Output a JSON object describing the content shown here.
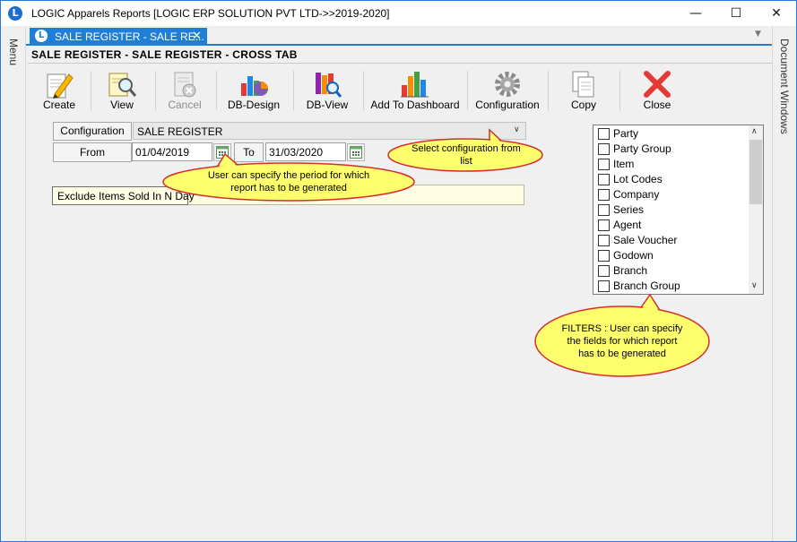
{
  "window": {
    "title": "LOGIC Apparels Reports  [LOGIC ERP SOLUTION PVT LTD->>2019-2020]",
    "app_icon_glyph": "L",
    "minimize_glyph": "—",
    "maximize_glyph": "☐",
    "close_glyph": "✕"
  },
  "rails": {
    "left_label": "Menu",
    "right_label": "Document Windows"
  },
  "tabs": {
    "active_label": "SALE REGISTER - SALE RE...",
    "close_glyph": "✕",
    "overflow_glyph": "▼"
  },
  "page": {
    "heading": "SALE REGISTER - SALE REGISTER - CROSS TAB"
  },
  "toolbar": {
    "create": "Create",
    "view": "View",
    "cancel": "Cancel",
    "db_design": "DB-Design",
    "db_view": "DB-View",
    "add_dashboard": "Add To Dashboard",
    "configuration": "Configuration",
    "copy": "Copy",
    "close": "Close"
  },
  "form": {
    "configuration_label": "Configuration",
    "configuration_value": "SALE REGISTER",
    "combo_arrow": "∨",
    "from_label": "From",
    "from_value": "01/04/2019",
    "to_label": "To",
    "to_value": "31/03/2020",
    "exclude_label": "Exclude Items Sold In N Day",
    "exclude_value": ""
  },
  "filters": {
    "items": [
      {
        "label": "Party",
        "checked": false
      },
      {
        "label": "Party Group",
        "checked": false
      },
      {
        "label": "Item",
        "checked": false
      },
      {
        "label": "Lot Codes",
        "checked": false
      },
      {
        "label": "Company",
        "checked": false
      },
      {
        "label": "Series",
        "checked": false
      },
      {
        "label": "Agent",
        "checked": false
      },
      {
        "label": "Sale Voucher",
        "checked": false
      },
      {
        "label": "Godown",
        "checked": false
      },
      {
        "label": "Branch",
        "checked": false
      },
      {
        "label": "Branch Group",
        "checked": false
      }
    ],
    "scroll_up": "∧",
    "scroll_down": "∨"
  },
  "callouts": {
    "period": "User can specify the period for which report has to be generated",
    "configuration": "Select configuration from list",
    "filters": "FILTERS : User can specify the fields for which report has to be generated"
  },
  "colors": {
    "accent": "#1f7fd8",
    "callout_fill": "#ffff6e",
    "callout_stroke": "#d32f2f"
  }
}
